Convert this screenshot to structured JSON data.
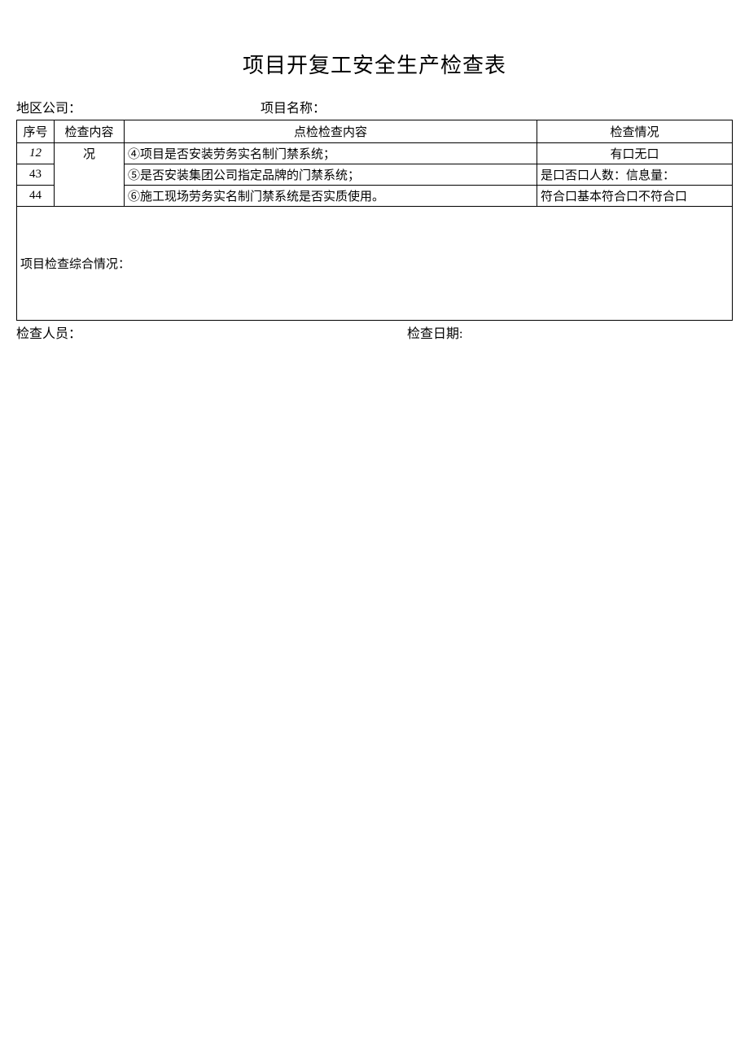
{
  "title": "项目开复工安全生产检查表",
  "meta": {
    "region_label": "地区公司：",
    "project_label": "项目名称："
  },
  "headers": {
    "seq": "序号",
    "category": "检查内容",
    "item": "点检检查内容",
    "status": "检查情况"
  },
  "category_cell": "况",
  "rows": [
    {
      "seq": "12",
      "seq_italic": true,
      "item": "④项目是否安装劳务实名制门禁系统；",
      "status": "有口无口"
    },
    {
      "seq": "43",
      "seq_italic": false,
      "item": "⑤是否安装集团公司指定品牌的门禁系统；",
      "status": "是口否口人数：信息量："
    },
    {
      "seq": "44",
      "seq_italic": false,
      "item": "⑥施工现场劳务实名制门禁系统是否实质使用。",
      "status": "符合口基本符合口不符合口"
    }
  ],
  "summary_label": "项目检查综合情况：",
  "footer": {
    "inspector_label": "检查人员：",
    "date_label": "检查日期:"
  }
}
